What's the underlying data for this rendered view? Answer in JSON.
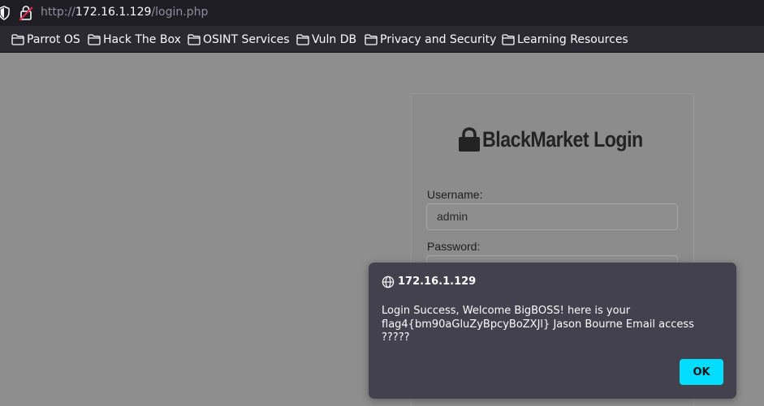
{
  "browser": {
    "url_prefix": "http://",
    "url_host": "172.16.1.129",
    "url_path": "/login.php"
  },
  "bookmarks": [
    {
      "label": "Parrot OS",
      "icon": "folder-icon"
    },
    {
      "label": "Hack The Box",
      "icon": "folder-icon"
    },
    {
      "label": "OSINT Services",
      "icon": "folder-icon"
    },
    {
      "label": "Vuln DB",
      "icon": "folder-icon"
    },
    {
      "label": "Privacy and Security",
      "icon": "folder-icon"
    },
    {
      "label": "Learning Resources",
      "icon": "folder-icon"
    }
  ],
  "login": {
    "title": "BlackMarket Login",
    "title_icon": "lock-icon",
    "username_label": "Username:",
    "username_value": "admin",
    "password_label": "Password:"
  },
  "alert": {
    "origin": "172.16.1.129",
    "message": "Login Success, Welcome BigBOSS! here is your flag4{bm90aGluZyBpcyBoZXJl} Jason Bourne Email access ?????",
    "ok_label": "OK"
  },
  "colors": {
    "accent": "#00ddff",
    "dialog_bg": "#42414d",
    "toolbar_bg": "#2b2a33"
  }
}
